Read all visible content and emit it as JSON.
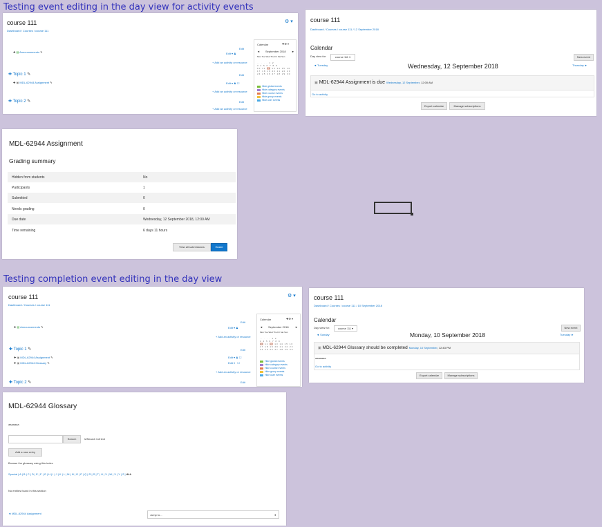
{
  "headings": {
    "first": "Testing event editing in the day view for activity events",
    "second": "Testing completion event editing in the day view"
  },
  "course1": {
    "title": "course 111",
    "breadcrumb": "Dashboard / Courses / course 111",
    "announcements": "Announcements",
    "topic1": "Topic 1",
    "topic2": "Topic 2",
    "assignment": "MDL-62944 Assignment",
    "edit": "Edit",
    "add_activity": "+ Add an activity or resource",
    "calendar_label": "Calendar",
    "cal_month": "September 2018",
    "cal_days": "Mon Tue Wed Thu Fri Sat Sun",
    "legend": [
      "Hide global events",
      "Hide category events",
      "Hide course events",
      "Hide group events",
      "Hide user events"
    ]
  },
  "calendar1": {
    "title": "course 111",
    "breadcrumb": "Dashboard / Courses / course 111 / 12 September 2018",
    "heading": "Calendar",
    "day_view_for": "Day view for:",
    "course_select": "course 111",
    "new_event": "New event",
    "prev": "◄ Tuesday",
    "next": "Thursday ►",
    "date_title": "Wednesday, 12 September 2018",
    "event_name": "MDL-62944 Assignment is due",
    "event_date": "Wednesday, 12 September",
    "event_time": ", 12:00 AM",
    "go_to_activity": "Go to activity",
    "export": "Export calendar",
    "manage": "Manage subscriptions"
  },
  "grading": {
    "title": "MDL-62944 Assignment",
    "subtitle": "Grading summary",
    "rows": [
      {
        "k": "Hidden from students",
        "v": "No"
      },
      {
        "k": "Participants",
        "v": "1"
      },
      {
        "k": "Submitted",
        "v": "0"
      },
      {
        "k": "Needs grading",
        "v": "0"
      },
      {
        "k": "Due date",
        "v": "Wednesday, 12 September 2018, 12:00 AM"
      },
      {
        "k": "Time remaining",
        "v": "6 days 11 hours"
      }
    ],
    "view_all": "View all submissions",
    "grade": "Grade"
  },
  "course2": {
    "title": "course 111",
    "breadcrumb": "Dashboard / Courses / course 111",
    "announcements": "Announcements",
    "topic1": "Topic 1",
    "topic2": "Topic 2",
    "assignment": "MDL-62944 Assignment",
    "glossary": "MDL-62944 Glossary",
    "edit": "Edit",
    "add_activity": "+ Add an activity or resource",
    "calendar_label": "Calendar",
    "cal_month": "September 2018",
    "cal_days": "Mon Tue Wed Thu Fri Sat Sun",
    "legend": [
      "Hide global events",
      "Hide category events",
      "Hide course events",
      "Hide group events",
      "Hide user events"
    ]
  },
  "calendar2": {
    "title": "course 111",
    "breadcrumb": "Dashboard / Courses / course 111 / 10 September 2018",
    "heading": "Calendar",
    "day_view_for": "Day view for:",
    "course_select": "course 111",
    "new_event": "New event",
    "prev": "◄ Sunday",
    "next": "Tuesday ►",
    "date_title": "Monday, 10 September 2018",
    "event_name": "MDL-62944 Glossary should be completed",
    "event_date": "Monday, 10 September",
    "event_time": ", 12:43 PM",
    "desc": "aaaaaaa",
    "go_to_activity": "Go to activity",
    "export": "Export calendar",
    "manage": "Manage subscriptions"
  },
  "glossary": {
    "title": "MDL-62944 Glossary",
    "desc": "aaaaaaa",
    "search_btn": "Search",
    "search_full": "Search full text",
    "add_entry": "Add a new entry",
    "browse": "Browse the glossary using this index",
    "index": "Special | A | B | C | D | E | F | G | H | I | J | K | L | M | N | O | P | Q | R | S | T | U | V | W | X | Y | Z |",
    "index_all": "ALL",
    "no_entries": "No entries found in this section",
    "back_link": "◄ MDL-62944 Assignment",
    "jump_to": "Jump to..."
  }
}
